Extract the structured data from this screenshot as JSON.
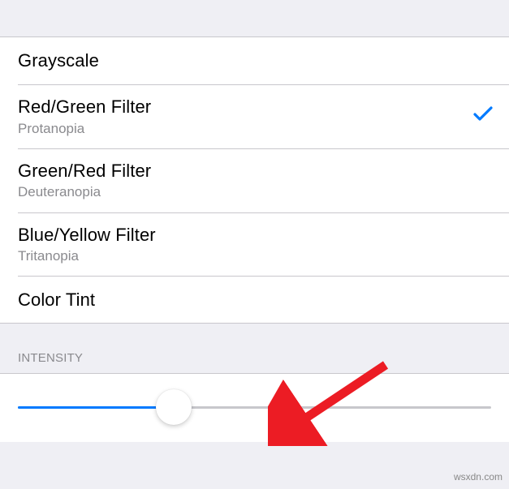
{
  "filters": {
    "items": [
      {
        "title": "Grayscale",
        "subtitle": null,
        "selected": false
      },
      {
        "title": "Red/Green Filter",
        "subtitle": "Protanopia",
        "selected": true
      },
      {
        "title": "Green/Red Filter",
        "subtitle": "Deuteranopia",
        "selected": false
      },
      {
        "title": "Blue/Yellow Filter",
        "subtitle": "Tritanopia",
        "selected": false
      },
      {
        "title": "Color Tint",
        "subtitle": null,
        "selected": false
      }
    ]
  },
  "intensity": {
    "header": "INTENSITY",
    "value_percent": 33
  },
  "colors": {
    "accent": "#007aff",
    "arrow": "#ec1c24"
  },
  "watermark": "wsxdn.com"
}
